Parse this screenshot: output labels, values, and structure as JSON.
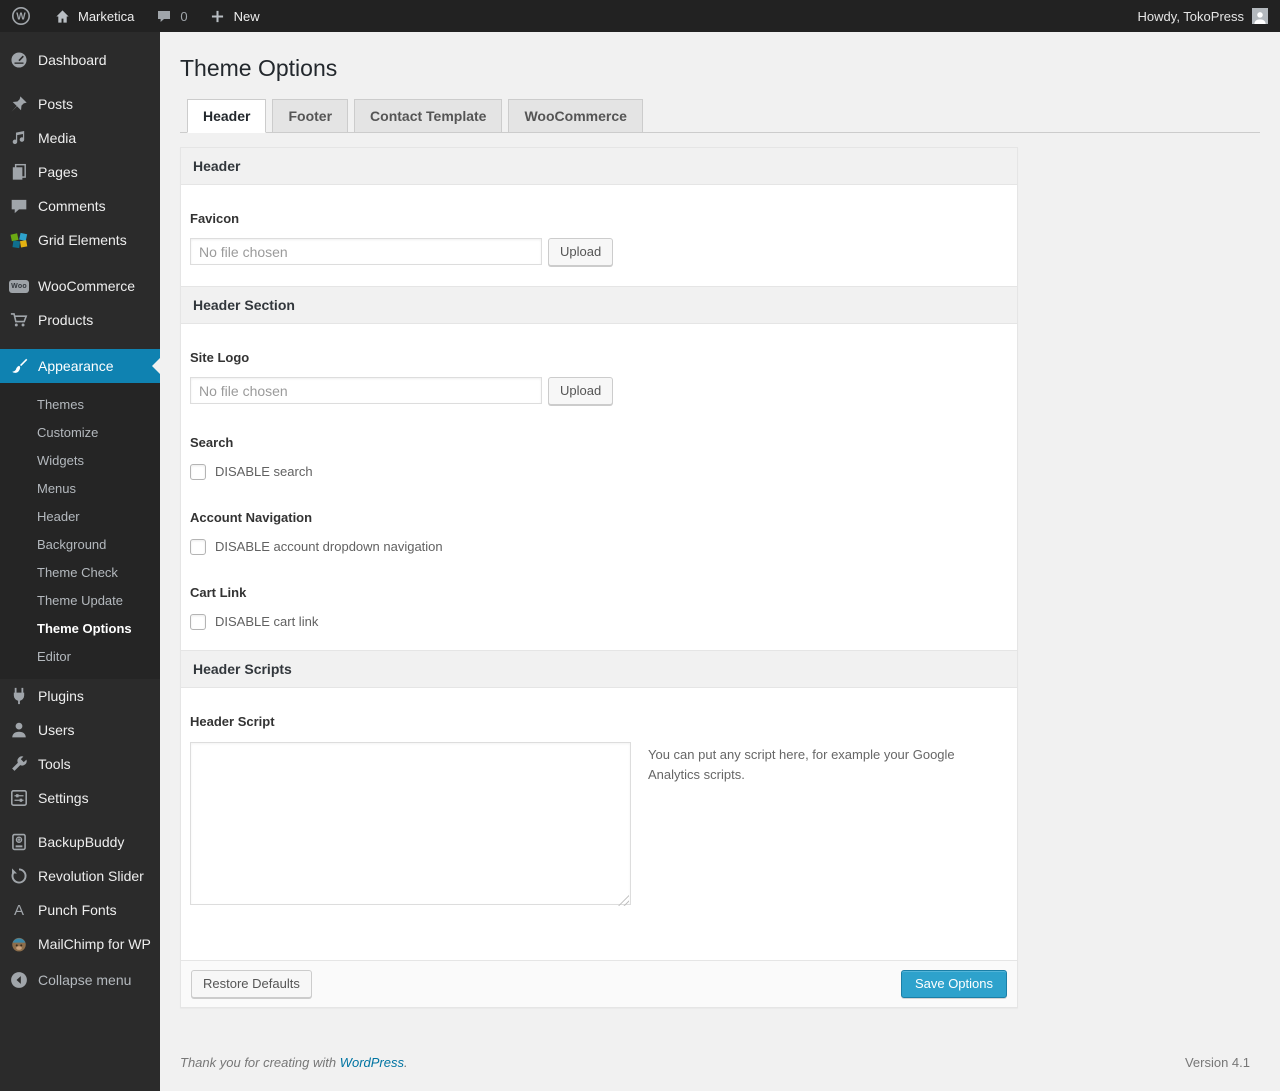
{
  "admin_bar": {
    "site_name": "Marketica",
    "comment_count": "0",
    "new_label": "New",
    "howdy": "Howdy, TokoPress"
  },
  "sidebar": {
    "items": [
      {
        "label": "Dashboard",
        "icon": "dashboard-icon"
      },
      {
        "label": "Posts",
        "icon": "pin-icon"
      },
      {
        "label": "Media",
        "icon": "media-icon"
      },
      {
        "label": "Pages",
        "icon": "pages-icon"
      },
      {
        "label": "Comments",
        "icon": "comment-icon"
      },
      {
        "label": "Grid Elements",
        "icon": "grid-elements-icon"
      },
      {
        "label": "WooCommerce",
        "icon": "woo-badge-icon"
      },
      {
        "label": "Products",
        "icon": "cart-icon"
      },
      {
        "label": "Appearance",
        "icon": "brush-icon",
        "active": true
      },
      {
        "label": "Plugins",
        "icon": "plug-icon"
      },
      {
        "label": "Users",
        "icon": "user-icon"
      },
      {
        "label": "Tools",
        "icon": "wrench-icon"
      },
      {
        "label": "Settings",
        "icon": "settings-icon"
      },
      {
        "label": "BackupBuddy",
        "icon": "backup-drive-icon"
      },
      {
        "label": "Revolution Slider",
        "icon": "refresh-icon"
      },
      {
        "label": "Punch Fonts",
        "icon": "letter-a-icon"
      },
      {
        "label": "MailChimp for WP",
        "icon": "mailchimp-icon"
      },
      {
        "label": "Collapse menu",
        "icon": "collapse-arrow-icon"
      }
    ],
    "woo_badge_text": "Woo",
    "letter_a_text": "A",
    "appearance_submenu": [
      "Themes",
      "Customize",
      "Widgets",
      "Menus",
      "Header",
      "Background",
      "Theme Check",
      "Theme Update",
      "Theme Options",
      "Editor"
    ],
    "current_submenu": "Theme Options"
  },
  "page": {
    "title": "Theme Options",
    "tabs": [
      {
        "label": "Header",
        "active": true
      },
      {
        "label": "Footer",
        "active": false
      },
      {
        "label": "Contact Template",
        "active": false
      },
      {
        "label": "WooCommerce",
        "active": false
      }
    ]
  },
  "panel": {
    "header_section_title": "Header",
    "favicon_label": "Favicon",
    "file_placeholder": "No file chosen",
    "upload_label": "Upload",
    "header_area_title": "Header Section",
    "site_logo_label": "Site Logo",
    "search_label": "Search",
    "disable_search_label": "DISABLE search",
    "disable_search_checked": false,
    "account_nav_label": "Account Navigation",
    "disable_account_label": "DISABLE account dropdown navigation",
    "disable_account_checked": false,
    "cart_link_label": "Cart Link",
    "disable_cart_label": "DISABLE cart link",
    "disable_cart_checked": false,
    "scripts_section_title": "Header Scripts",
    "header_script_label": "Header Script",
    "script_value": "",
    "script_hint": "You can put any script here, for example your Google Analytics scripts.",
    "restore_label": "Restore Defaults",
    "save_label": "Save Options"
  },
  "footer": {
    "thanks_prefix": "Thank you for creating with ",
    "wordpress_link": "WordPress",
    "thanks_suffix": ".",
    "version": "Version 4.1"
  },
  "colors": {
    "accent_button": "#2ea2cc",
    "menu_highlight": "#0f82b1",
    "admin_bar_bg": "#222222",
    "sidebar_bg": "#2b2b2b",
    "page_bg": "#f1f1f1",
    "link": "#0074a2"
  }
}
